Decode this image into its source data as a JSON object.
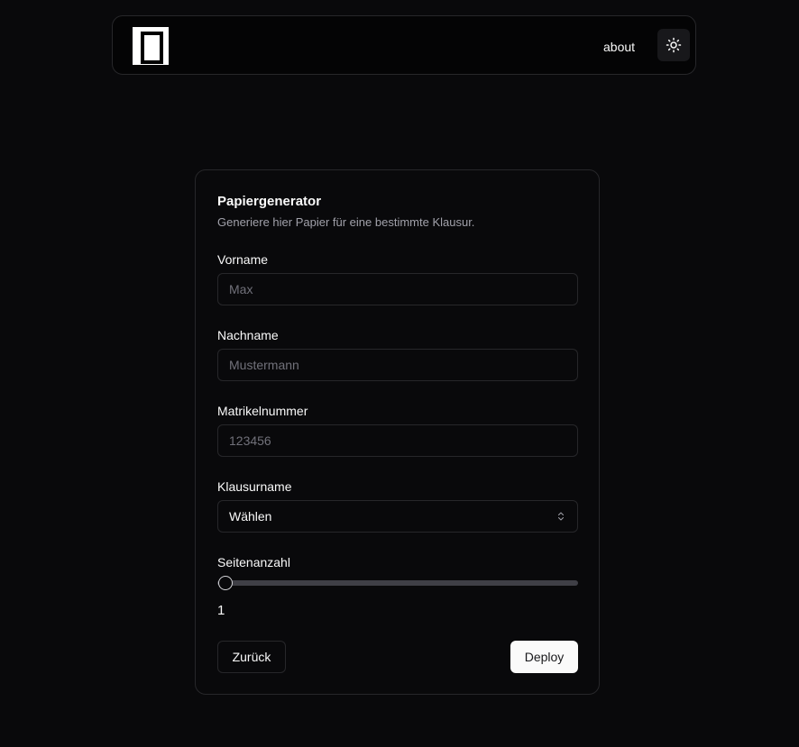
{
  "nav": {
    "about_label": "about",
    "theme_icon": "sun-icon"
  },
  "card": {
    "title": "Papiergenerator",
    "description": "Generiere hier Papier für eine bestimmte Klausur."
  },
  "form": {
    "first_name": {
      "label": "Vorname",
      "placeholder": "Max",
      "value": ""
    },
    "last_name": {
      "label": "Nachname",
      "placeholder": "Mustermann",
      "value": ""
    },
    "matriculation": {
      "label": "Matrikelnummer",
      "placeholder": "123456",
      "value": ""
    },
    "exam": {
      "label": "Klausurname",
      "selected": "Wählen"
    },
    "pages": {
      "label": "Seitenanzahl",
      "value": "1"
    }
  },
  "actions": {
    "back_label": "Zurück",
    "deploy_label": "Deploy"
  },
  "colors": {
    "background": "#09090b",
    "border": "#27272a",
    "muted_text": "#a1a1aa",
    "primary_button": "#fafafa"
  }
}
